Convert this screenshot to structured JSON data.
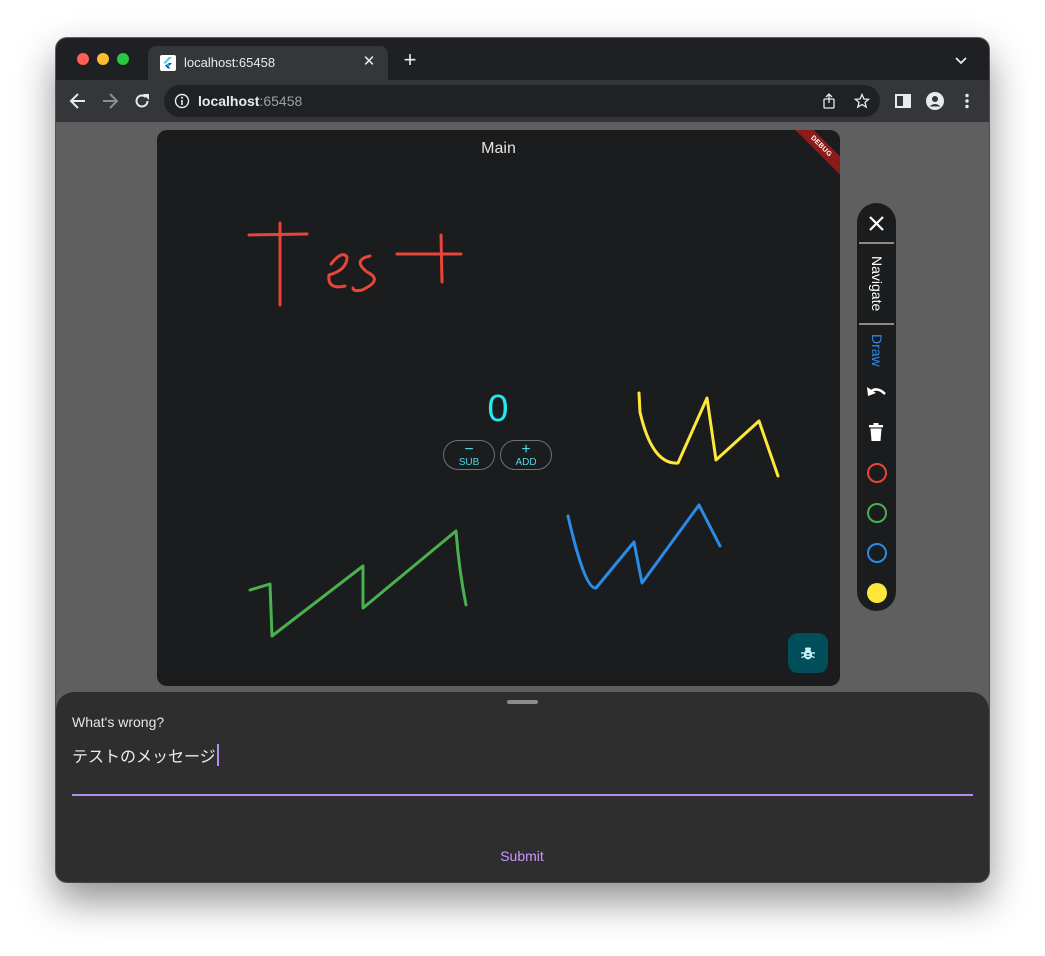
{
  "browser": {
    "tab_title": "localhost:65458",
    "tab_close_glyph": "✕",
    "new_tab_glyph": "+",
    "url_host": "localhost",
    "url_port": ":65458"
  },
  "app": {
    "title": "Main",
    "debug_banner": "DEBUG",
    "counter": {
      "value": "0",
      "subtract_symbol": "−",
      "subtract_label": "SUB",
      "add_symbol": "+",
      "add_label": "ADD"
    },
    "drawing": {
      "text_strokes": "Test",
      "stroke_colors": {
        "red": "#e8453a",
        "yellow": "#ffe63b",
        "blue": "#2b8be6",
        "green": "#4ab14f"
      }
    },
    "fab_icon": "bug-icon"
  },
  "side_toolbar": {
    "close_icon": "close-icon",
    "navigate_label": "Navigate",
    "draw_label": "Draw",
    "undo_icon": "undo-icon",
    "clear_icon": "trash-icon",
    "colors": [
      {
        "name": "red",
        "hex": "#e8453a",
        "selected": false
      },
      {
        "name": "green",
        "hex": "#4ab14f",
        "selected": false
      },
      {
        "name": "blue",
        "hex": "#2b8be6",
        "selected": false
      },
      {
        "name": "yellow",
        "hex": "#ffe63b",
        "selected": true
      }
    ]
  },
  "feedback_sheet": {
    "label": "What's wrong?",
    "input_value": "テストのメッセージ",
    "submit_label": "Submit",
    "accent_color": "#b68cf2"
  }
}
